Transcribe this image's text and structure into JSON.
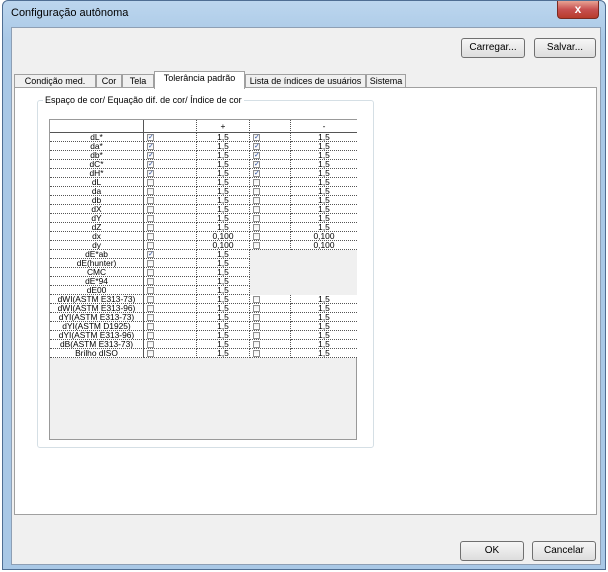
{
  "window": {
    "title": "Configuração autônoma",
    "close_glyph": "x"
  },
  "buttons": {
    "load": "Carregar...",
    "save": "Salvar...",
    "ok": "OK",
    "cancel": "Cancelar"
  },
  "tabs": [
    {
      "label": "Condição med.",
      "active": false
    },
    {
      "label": "Cor",
      "active": false
    },
    {
      "label": "Tela",
      "active": false
    },
    {
      "label": "Tolerância padrão",
      "active": true
    },
    {
      "label": "Lista de índices de usuários",
      "active": false
    },
    {
      "label": "Sistema",
      "active": false
    }
  ],
  "group_label": "Espaço de cor/ Equação dif. de cor/ Índice de cor",
  "table": {
    "headers": {
      "plus": "+",
      "minus": "-"
    },
    "rows": [
      {
        "label": "dL*",
        "chk1": true,
        "plus": "1,5",
        "chk2": true,
        "minus": "1,5"
      },
      {
        "label": "da*",
        "chk1": true,
        "plus": "1,5",
        "chk2": true,
        "minus": "1,5"
      },
      {
        "label": "db*",
        "chk1": true,
        "plus": "1,5",
        "chk2": true,
        "minus": "1,5"
      },
      {
        "label": "dC*",
        "chk1": true,
        "plus": "1,5",
        "chk2": true,
        "minus": "1,5"
      },
      {
        "label": "dH*",
        "chk1": true,
        "plus": "1,5",
        "chk2": true,
        "minus": "1,5"
      },
      {
        "label": "dL",
        "chk1": false,
        "plus": "1,5",
        "chk2": false,
        "minus": "1,5"
      },
      {
        "label": "da",
        "chk1": false,
        "plus": "1,5",
        "chk2": false,
        "minus": "1,5"
      },
      {
        "label": "db",
        "chk1": false,
        "plus": "1,5",
        "chk2": false,
        "minus": "1,5"
      },
      {
        "label": "dX",
        "chk1": false,
        "plus": "1,5",
        "chk2": false,
        "minus": "1,5"
      },
      {
        "label": "dY",
        "chk1": false,
        "plus": "1,5",
        "chk2": false,
        "minus": "1,5"
      },
      {
        "label": "dZ",
        "chk1": false,
        "plus": "1,5",
        "chk2": false,
        "minus": "1,5"
      },
      {
        "label": "dx",
        "chk1": false,
        "plus": "0,100",
        "chk2": false,
        "minus": "0,100"
      },
      {
        "label": "dy",
        "chk1": false,
        "plus": "0,100",
        "chk2": false,
        "minus": "0,100"
      },
      {
        "label": "dE*ab",
        "chk1": true,
        "plus": "1,5",
        "chk2": null,
        "minus": null
      },
      {
        "label": "dE(hunter)",
        "chk1": false,
        "plus": "1,5",
        "chk2": null,
        "minus": null
      },
      {
        "label": "CMC",
        "chk1": false,
        "plus": "1,5",
        "chk2": null,
        "minus": null
      },
      {
        "label": "dE*94",
        "chk1": false,
        "plus": "1,5",
        "chk2": null,
        "minus": null
      },
      {
        "label": "dE00",
        "chk1": false,
        "plus": "1,5",
        "chk2": null,
        "minus": null
      },
      {
        "label": "dWI(ASTM E313-73)",
        "chk1": false,
        "plus": "1,5",
        "chk2": false,
        "minus": "1,5"
      },
      {
        "label": "dWI(ASTM E313-96)",
        "chk1": false,
        "plus": "1,5",
        "chk2": false,
        "minus": "1,5"
      },
      {
        "label": "dYI(ASTM E313-73)",
        "chk1": false,
        "plus": "1,5",
        "chk2": false,
        "minus": "1,5"
      },
      {
        "label": "dYI(ASTM D1925)",
        "chk1": false,
        "plus": "1,5",
        "chk2": false,
        "minus": "1,5"
      },
      {
        "label": "dYI(ASTM E313-96)",
        "chk1": false,
        "plus": "1,5",
        "chk2": false,
        "minus": "1,5"
      },
      {
        "label": "dB(ASTM E313-73)",
        "chk1": false,
        "plus": "1,5",
        "chk2": false,
        "minus": "1,5"
      },
      {
        "label": "Brilho dISO",
        "chk1": false,
        "plus": "1,5",
        "chk2": false,
        "minus": "1,5"
      }
    ]
  }
}
